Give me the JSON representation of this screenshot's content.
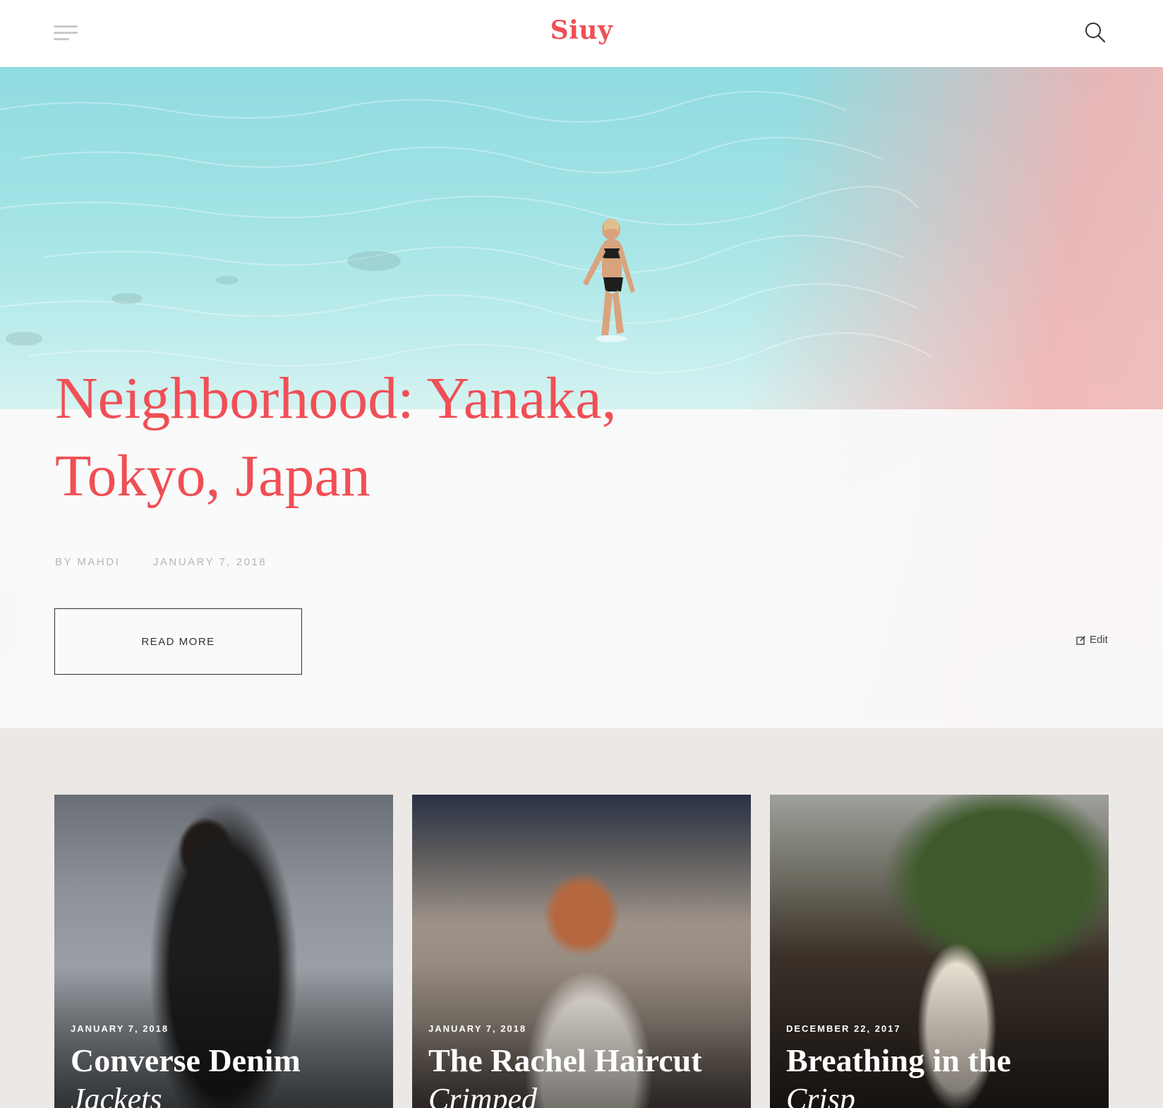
{
  "header": {
    "logo": "Siuy",
    "menu_icon": "hamburger-menu-icon",
    "search_icon": "search-icon"
  },
  "hero": {
    "title_line1": "Neighborhood: Yanaka,",
    "title_line2": "Tokyo, Japan",
    "author": "BY MAHDI",
    "date": "JANUARY 7, 2018",
    "read_more": "READ MORE",
    "edit": "Edit",
    "title_color": "#f04f55"
  },
  "posts": [
    {
      "date": "JANUARY 7, 2018",
      "title": "Converse Denim",
      "subtitle": "Jackets"
    },
    {
      "date": "JANUARY 7, 2018",
      "title": "The Rachel Haircut",
      "subtitle": "Crimped"
    },
    {
      "date": "DECEMBER 22, 2017",
      "title": "Breathing in the",
      "subtitle": "Crisp"
    }
  ],
  "colors": {
    "accent": "#f04f55",
    "section_bg": "#ece8e6"
  }
}
